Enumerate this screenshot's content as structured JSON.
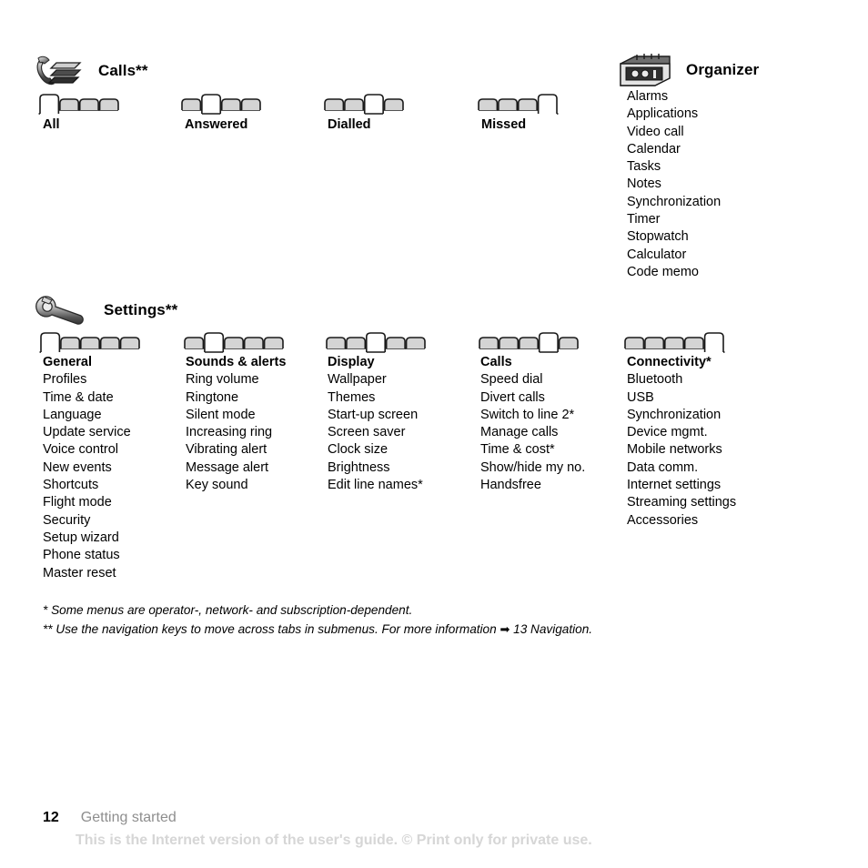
{
  "sections": {
    "calls": {
      "icon": "phone-calls-icon",
      "title": "Calls**",
      "tab_groups": [
        {
          "label": "All",
          "tab_count": 4,
          "selected_index": 1
        },
        {
          "label": "Answered",
          "tab_count": 4,
          "selected_index": 2
        },
        {
          "label": "Dialled",
          "tab_count": 4,
          "selected_index": 3
        },
        {
          "label": "Missed",
          "tab_count": 4,
          "selected_index": 4
        }
      ]
    },
    "organizer": {
      "icon": "organizer-notepad-icon",
      "title": "Organizer",
      "items": [
        "Alarms",
        "Applications",
        "Video call",
        "Calendar",
        "Tasks",
        "Notes",
        "Synchronization",
        "Timer",
        "Stopwatch",
        "Calculator",
        "Code memo"
      ]
    },
    "settings": {
      "icon": "wrench-settings-icon",
      "title": "Settings**",
      "columns": [
        {
          "heading": "General",
          "tab_count": 5,
          "selected_index": 1,
          "items": [
            "Profiles",
            "Time & date",
            "Language",
            "Update service",
            "Voice control",
            "New events",
            "Shortcuts",
            "Flight mode",
            "Security",
            "Setup wizard",
            "Phone status",
            "Master reset"
          ]
        },
        {
          "heading": "Sounds & alerts",
          "tab_count": 5,
          "selected_index": 2,
          "items": [
            "Ring volume",
            "Ringtone",
            "Silent mode",
            "Increasing ring",
            "Vibrating alert",
            "Message alert",
            "Key sound"
          ]
        },
        {
          "heading": "Display",
          "tab_count": 5,
          "selected_index": 3,
          "items": [
            "Wallpaper",
            "Themes",
            "Start-up screen",
            "Screen saver",
            "Clock size",
            "Brightness",
            "Edit line names*"
          ]
        },
        {
          "heading": "Calls",
          "tab_count": 5,
          "selected_index": 4,
          "items": [
            "Speed dial",
            "Divert calls",
            "Switch to line 2*",
            "Manage calls",
            "Time & cost*",
            "Show/hide my no.",
            "Handsfree"
          ]
        },
        {
          "heading": "Connectivity*",
          "tab_count": 5,
          "selected_index": 5,
          "items": [
            "Bluetooth",
            "USB",
            "Synchronization",
            "Device mgmt.",
            "Mobile networks",
            "Data comm.",
            "Internet settings",
            "Streaming settings",
            "Accessories"
          ]
        }
      ]
    }
  },
  "footnotes": [
    {
      "marker": "*",
      "text": " Some menus are operator-, network- and subscription-dependent."
    },
    {
      "marker": "**",
      "text": " Use the navigation keys to move across tabs in submenus. For more information ",
      "arrow": "➡",
      "tail": " 13 Navigation."
    }
  ],
  "footer": {
    "page_number": "12",
    "section_name": "Getting started",
    "watermark": "This is the Internet version of the user's guide. © Print only for private use."
  },
  "colors": {
    "tab_fill_unselected": "#d4d4d4",
    "tab_fill_selected": "#ffffff",
    "tab_stroke": "#1a1a1a",
    "footer_section": "#8e8e8e",
    "watermark": "#d6d6d6"
  }
}
